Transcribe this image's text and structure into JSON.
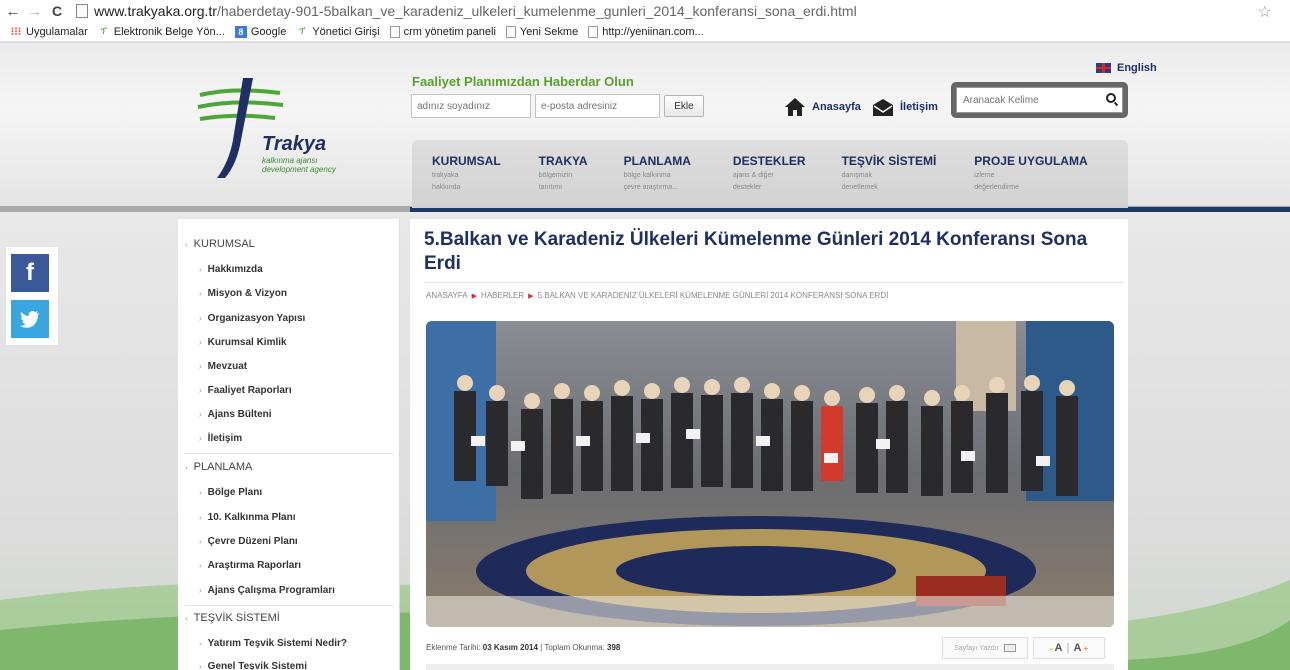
{
  "browser": {
    "url_host": "www.trakyaka.org.tr",
    "url_path": "/haberdetay-901-5balkan_ve_karadeniz_ulkeleri_kumelenme_gunleri_2014_konferansi_sona_erdi.html",
    "bookmarks": [
      "Uygulamalar",
      "Elektronik Belge Yön...",
      "Google",
      "Yönetici Girişi",
      "crm yönetim paneli",
      "Yeni Sekme",
      "http://yeniinan.com..."
    ]
  },
  "header": {
    "logo_title": "Trakya",
    "logo_sub1": "kalkınma ajansı",
    "logo_sub2": "development agency",
    "newsletter_title": "Faaliyet Planımızdan Haberdar Olun",
    "name_placeholder": "adınız soyadınız",
    "email_placeholder": "e-posta adresiniz",
    "add_button": "Ekle",
    "english": "English",
    "home": "Anasayfa",
    "contact": "İletişim",
    "search_placeholder": "Aranacak Kelime"
  },
  "nav": [
    {
      "title": "KURUMSAL",
      "sub1": "trakyaka",
      "sub2": "hakkında"
    },
    {
      "title": "TRAKYA",
      "sub1": "bölgemizin",
      "sub2": "tanıtımı"
    },
    {
      "title": "PLANLAMA",
      "sub1": "bölge kalkınma",
      "sub2": "çevre araştırma..."
    },
    {
      "title": "DESTEKLER",
      "sub1": "ajans & diğer",
      "sub2": "destekler"
    },
    {
      "title": "TEŞVİK SİSTEMİ",
      "sub1": "danışmak",
      "sub2": "denetlemek"
    },
    {
      "title": "PROJE UYGULAMA",
      "sub1": "izleme",
      "sub2": "değerlendirme"
    }
  ],
  "sidebar": {
    "sections": [
      {
        "label": "KURUMSAL",
        "items": [
          "Hakkımızda",
          "Misyon & Vizyon",
          "Organizasyon Yapısı",
          "Kurumsal Kimlik",
          "Mevzuat",
          "Faaliyet Raporları",
          "Ajans Bülteni",
          "İletişim"
        ]
      },
      {
        "label": "PLANLAMA",
        "items": [
          "Bölge Planı",
          "10. Kalkınma Planı",
          "Çevre Düzeni Planı",
          "Araştırma Raporları",
          "Ajans Çalışma Programları"
        ]
      },
      {
        "label": "TEŞVİK SİSTEMİ",
        "items": [
          "Yatırım Teşvik Sistemi Nedir?",
          "Genel Teşvik Sistemi"
        ]
      }
    ]
  },
  "article": {
    "title": "5.Balkan ve Karadeniz Ülkeleri Kümelenme Günleri 2014 Konferansı Sona Erdi",
    "breadcrumb": [
      "ANASAYFA",
      "HABERLER",
      "5.BALKAN VE KARADENİZ ÜLKELERİ KÜMELENME GÜNLERİ 2014 KONFERANSI SONA ERDİ"
    ],
    "date_label": "Eklenme Tarihi:",
    "date": "03 Kasım 2014",
    "reads_label": "| Toplam Okunma:",
    "reads": "398",
    "print": "Sayfayı Yazdır",
    "font_a1": "A",
    "font_a2": "A",
    "font_plus": "+",
    "font_minus": "-"
  },
  "colors": {
    "brand_blue": "#1f2f63",
    "brand_green": "#58a12e",
    "facebook": "#3b5998",
    "twitter": "#3aa6e0"
  },
  "social": {
    "facebook": "f-icon",
    "twitter": "bird-icon"
  }
}
